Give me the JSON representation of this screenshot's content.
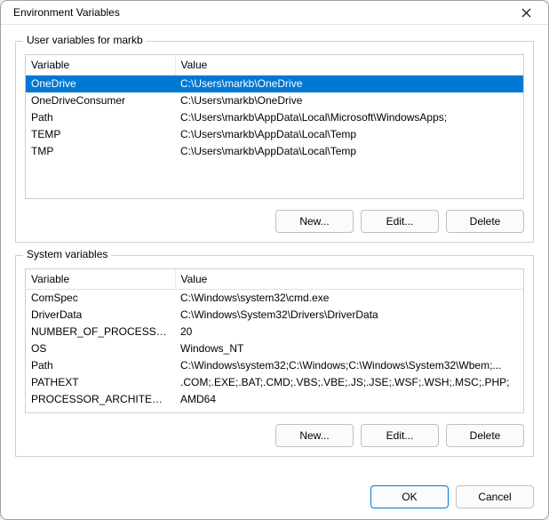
{
  "window": {
    "title": "Environment Variables"
  },
  "user_group": {
    "label": "User variables for markb",
    "columns": {
      "variable": "Variable",
      "value": "Value"
    },
    "rows": [
      {
        "variable": "OneDrive",
        "value": "C:\\Users\\markb\\OneDrive",
        "selected": true
      },
      {
        "variable": "OneDriveConsumer",
        "value": "C:\\Users\\markb\\OneDrive",
        "selected": false
      },
      {
        "variable": "Path",
        "value": "C:\\Users\\markb\\AppData\\Local\\Microsoft\\WindowsApps;",
        "selected": false
      },
      {
        "variable": "TEMP",
        "value": "C:\\Users\\markb\\AppData\\Local\\Temp",
        "selected": false
      },
      {
        "variable": "TMP",
        "value": "C:\\Users\\markb\\AppData\\Local\\Temp",
        "selected": false
      }
    ],
    "buttons": {
      "new": "New...",
      "edit": "Edit...",
      "delete": "Delete"
    }
  },
  "system_group": {
    "label": "System variables",
    "columns": {
      "variable": "Variable",
      "value": "Value"
    },
    "rows": [
      {
        "variable": "ComSpec",
        "value": "C:\\Windows\\system32\\cmd.exe"
      },
      {
        "variable": "DriverData",
        "value": "C:\\Windows\\System32\\Drivers\\DriverData"
      },
      {
        "variable": "NUMBER_OF_PROCESSORS",
        "value": "20"
      },
      {
        "variable": "OS",
        "value": "Windows_NT"
      },
      {
        "variable": "Path",
        "value": "C:\\Windows\\system32;C:\\Windows;C:\\Windows\\System32\\Wbem;..."
      },
      {
        "variable": "PATHEXT",
        "value": ".COM;.EXE;.BAT;.CMD;.VBS;.VBE;.JS;.JSE;.WSF;.WSH;.MSC;.PHP;"
      },
      {
        "variable": "PROCESSOR_ARCHITECTURE",
        "value": "AMD64"
      }
    ],
    "buttons": {
      "new": "New...",
      "edit": "Edit...",
      "delete": "Delete"
    }
  },
  "dialog_buttons": {
    "ok": "OK",
    "cancel": "Cancel"
  }
}
